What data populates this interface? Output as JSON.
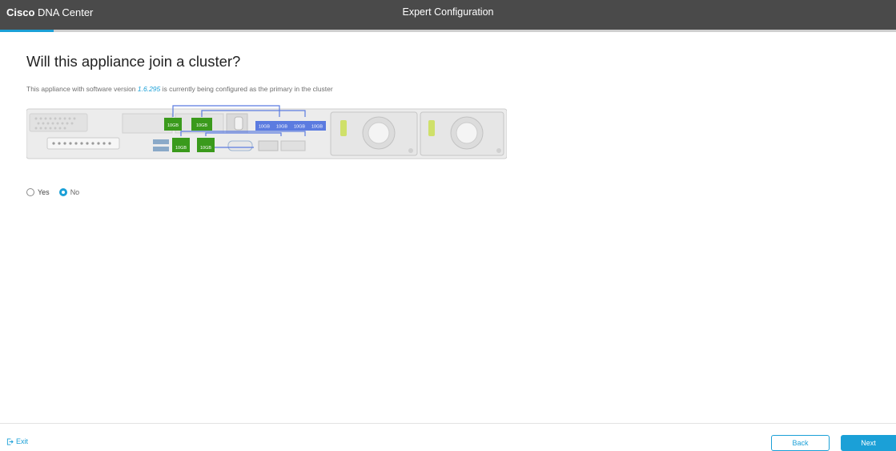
{
  "header": {
    "brand_bold": "Cisco",
    "brand_rest": " DNA Center",
    "page_title": "Expert Configuration",
    "progress_fraction": 0.06
  },
  "main": {
    "title": "Will this appliance join a cluster?",
    "subtitle_before": "This appliance with software version ",
    "software_version": "1.6.295",
    "subtitle_after": " is currently being configured as the primary in the cluster",
    "port_labels": {
      "p1": "10GB",
      "p2": "10GB",
      "p3": "10GB",
      "p4": "10GB",
      "p5": "10GB",
      "p6": "10GB",
      "p7": "10GB",
      "p8": "10GB"
    },
    "cluster_options": [
      {
        "label": "Yes",
        "selected": false
      },
      {
        "label": "No",
        "selected": true
      }
    ]
  },
  "footer": {
    "exit_label": "Exit",
    "back_label": "Back",
    "next_label": "Next"
  },
  "colors": {
    "accent": "#1ba0d7",
    "header_bg": "#4a4a4a",
    "port_green": "#3a9a1c",
    "port_blue": "#5b7be0"
  }
}
